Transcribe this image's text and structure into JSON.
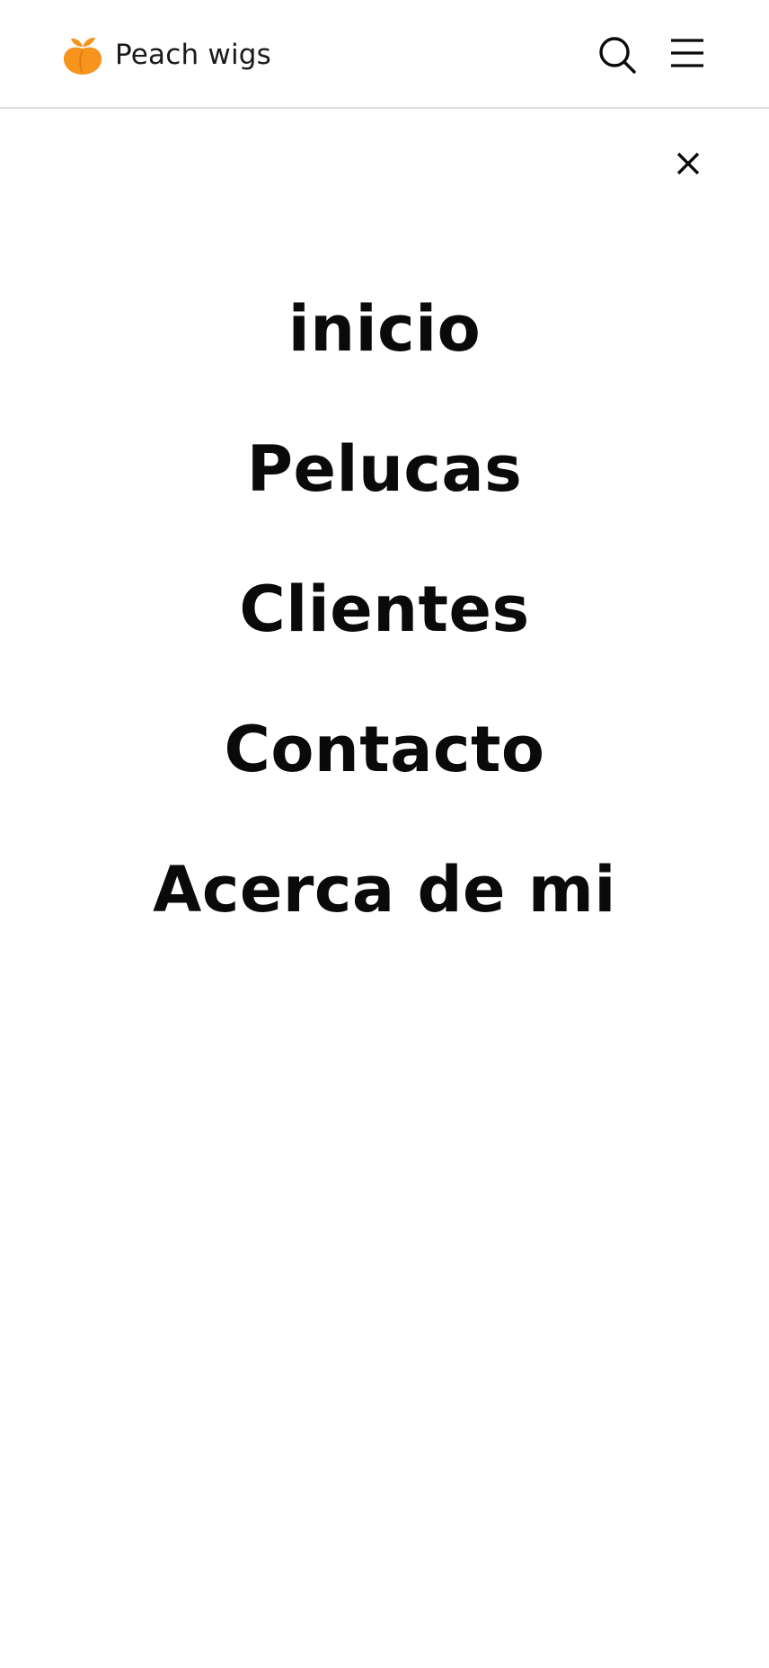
{
  "header": {
    "brand_name": "Peach wigs",
    "logo_icon": "peach-logo-icon",
    "brand_color": "#f7941d",
    "search_icon": "search-icon",
    "menu_icon": "hamburger-menu-icon"
  },
  "menu": {
    "close_icon": "close-icon",
    "items": [
      {
        "label": "inicio"
      },
      {
        "label": "Pelucas"
      },
      {
        "label": "Clientes"
      },
      {
        "label": "Contacto"
      },
      {
        "label": "Acerca de mi"
      }
    ]
  }
}
